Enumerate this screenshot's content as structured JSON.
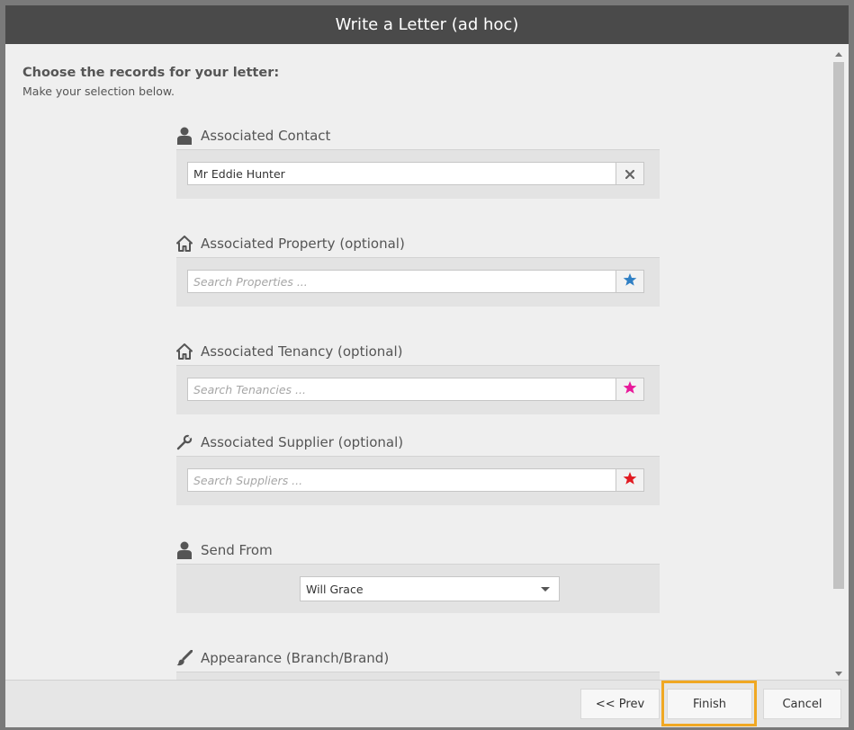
{
  "dialog": {
    "title": "Write a Letter (ad hoc)"
  },
  "intro": {
    "heading": "Choose the records for your letter:",
    "subheading": "Make your selection below."
  },
  "sections": {
    "contact": {
      "label": "Associated Contact",
      "icon": "person-icon",
      "value": "Mr Eddie Hunter",
      "button_icon": "clear-x-icon"
    },
    "property": {
      "label": "Associated Property (optional)",
      "icon": "house-icon",
      "placeholder": "Search Properties ...",
      "button_icon": "star-icon",
      "accent": "#2f7fc4"
    },
    "tenancy": {
      "label": "Associated Tenancy (optional)",
      "icon": "house-icon",
      "placeholder": "Search Tenancies ...",
      "button_icon": "star-icon",
      "accent": "#e8199a"
    },
    "supplier": {
      "label": "Associated Supplier (optional)",
      "icon": "wrench-icon",
      "placeholder": "Search Suppliers ...",
      "button_icon": "star-icon",
      "accent": "#e11b22"
    },
    "send_from": {
      "label": "Send From",
      "icon": "person-icon",
      "selected": "Will Grace"
    },
    "appearance": {
      "label": "Appearance (Branch/Brand)",
      "icon": "paintbrush-icon"
    }
  },
  "footer": {
    "prev_label": "<< Prev",
    "finish_label": "Finish",
    "cancel_label": "Cancel",
    "highlight_color": "#f0a823"
  }
}
